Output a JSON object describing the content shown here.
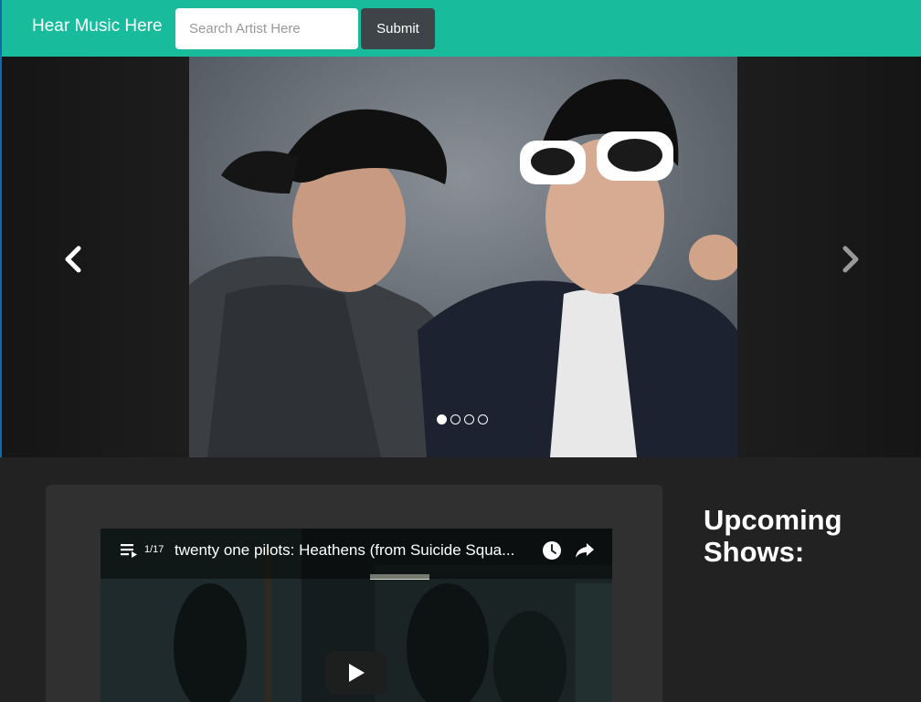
{
  "navbar": {
    "brand": "Hear Music Here",
    "search_placeholder": "Search Artist Here",
    "search_value": "",
    "submit_label": "Submit",
    "accent_color": "#18bc9c"
  },
  "carousel": {
    "prev_icon": "chevron-left-icon",
    "next_icon": "chevron-right-icon",
    "slide_count": 4,
    "active_index": 0
  },
  "video": {
    "playlist_position": "1/17",
    "title": "twenty one pilots: Heathens (from Suicide Squa...",
    "icons": [
      "playlist-icon",
      "watch-later-icon",
      "share-icon",
      "play-icon"
    ]
  },
  "shows": {
    "title": "Upcoming Shows:"
  }
}
